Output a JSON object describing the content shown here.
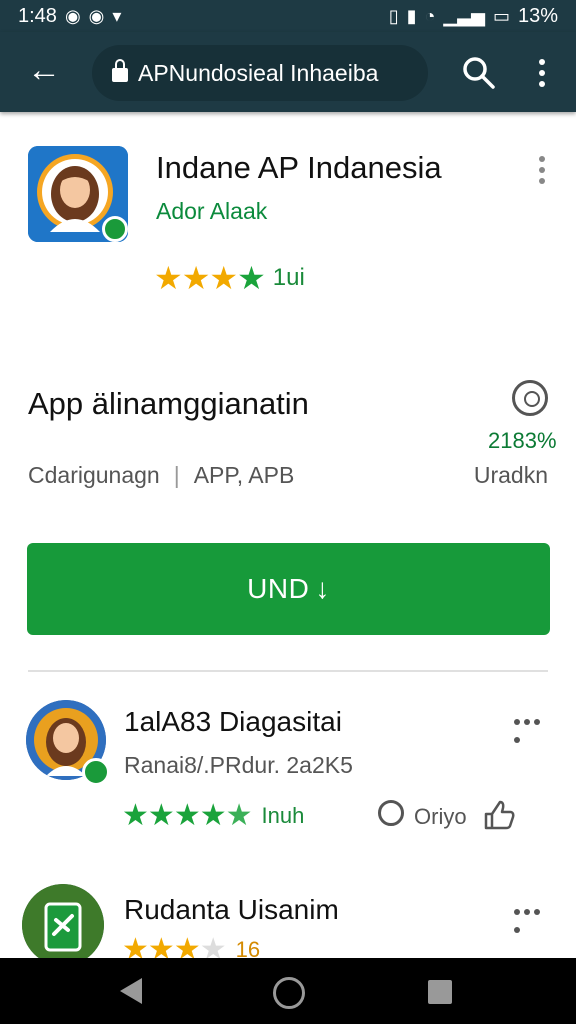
{
  "status_bar": {
    "time": "1:48",
    "battery": "13%"
  },
  "app_bar": {
    "url": "APNundosieal Inhaeiba"
  },
  "app": {
    "title": "Indane AP Indanesia",
    "developer": "Ador Alaak",
    "rating_value": 3.5,
    "rating_text": "1ui"
  },
  "info": {
    "title": "App älinamggianatin",
    "percent": "2183%",
    "meta_left": "Cdarigunagn",
    "meta_mid": "APP, APB",
    "meta_right": "Uradkn"
  },
  "install_button": {
    "label": "UND"
  },
  "related": [
    {
      "title": "1alA83 Diagasitai",
      "subtitle": "Ranai8/.PRdur. 2a2K5",
      "rating_value": 4.5,
      "rating_text": "Inuh",
      "comment_label": "Oriyo"
    },
    {
      "title": "Rudanta Uisanim",
      "rating_text": "16"
    }
  ],
  "colors": {
    "app_bar": "#1e3a44",
    "accent_green": "#179a3a",
    "star_orange": "#f2a900"
  }
}
